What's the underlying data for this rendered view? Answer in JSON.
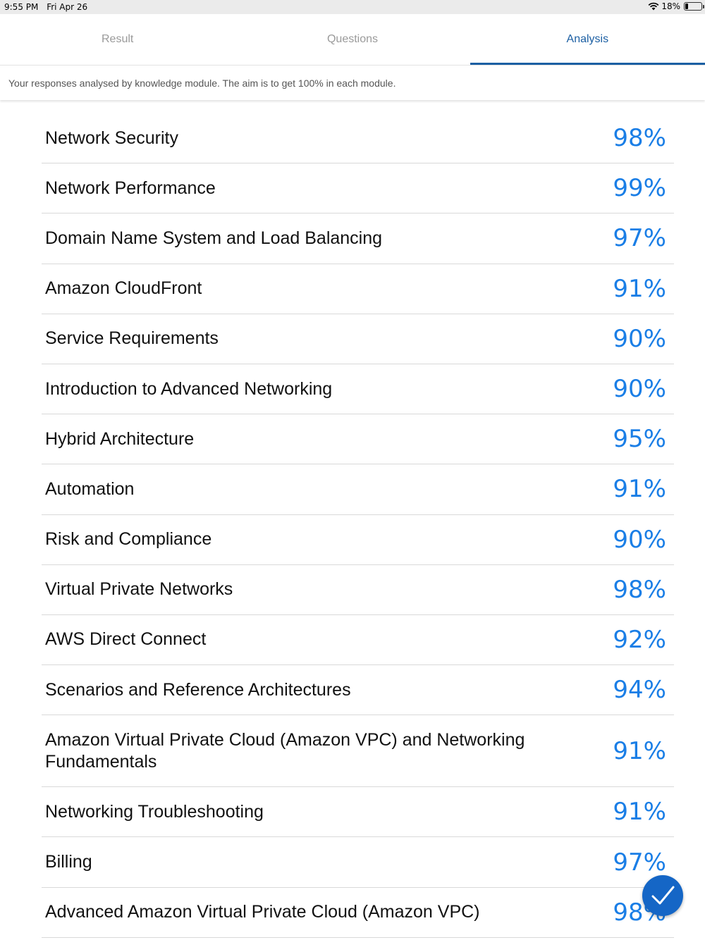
{
  "status_bar": {
    "time": "9:55 PM",
    "date": "Fri Apr 26",
    "battery": "18%",
    "battery_level": 0.18
  },
  "tabs": [
    {
      "label": "Result",
      "active": false
    },
    {
      "label": "Questions",
      "active": false
    },
    {
      "label": "Analysis",
      "active": true
    }
  ],
  "subtitle": "Your responses analysed by knowledge module. The aim is to get 100% in each module.",
  "modules": [
    {
      "name": "Network Security",
      "score": "98%"
    },
    {
      "name": "Network Performance",
      "score": "99%"
    },
    {
      "name": "Domain Name System and Load Balancing",
      "score": "97%"
    },
    {
      "name": "Amazon CloudFront",
      "score": "91%"
    },
    {
      "name": "Service Requirements",
      "score": "90%"
    },
    {
      "name": "Introduction to Advanced Networking",
      "score": "90%"
    },
    {
      "name": "Hybrid Architecture",
      "score": "95%"
    },
    {
      "name": "Automation",
      "score": "91%"
    },
    {
      "name": "Risk and Compliance",
      "score": "90%"
    },
    {
      "name": "Virtual Private Networks",
      "score": "98%"
    },
    {
      "name": "AWS Direct Connect",
      "score": "92%"
    },
    {
      "name": "Scenarios and Reference Architectures",
      "score": "94%"
    },
    {
      "name": "Amazon Virtual Private Cloud (Amazon VPC) and Networking Fundamentals",
      "score": "91%"
    },
    {
      "name": "Networking Troubleshooting",
      "score": "91%"
    },
    {
      "name": "Billing",
      "score": "97%"
    },
    {
      "name": "Advanced Amazon Virtual Private Cloud (Amazon VPC)",
      "score": "98%"
    }
  ],
  "fab": {
    "icon": "checkmark-icon",
    "color": "#1566c6"
  },
  "colors": {
    "accent": "#1c5fa3",
    "score": "#1a7ee6"
  }
}
